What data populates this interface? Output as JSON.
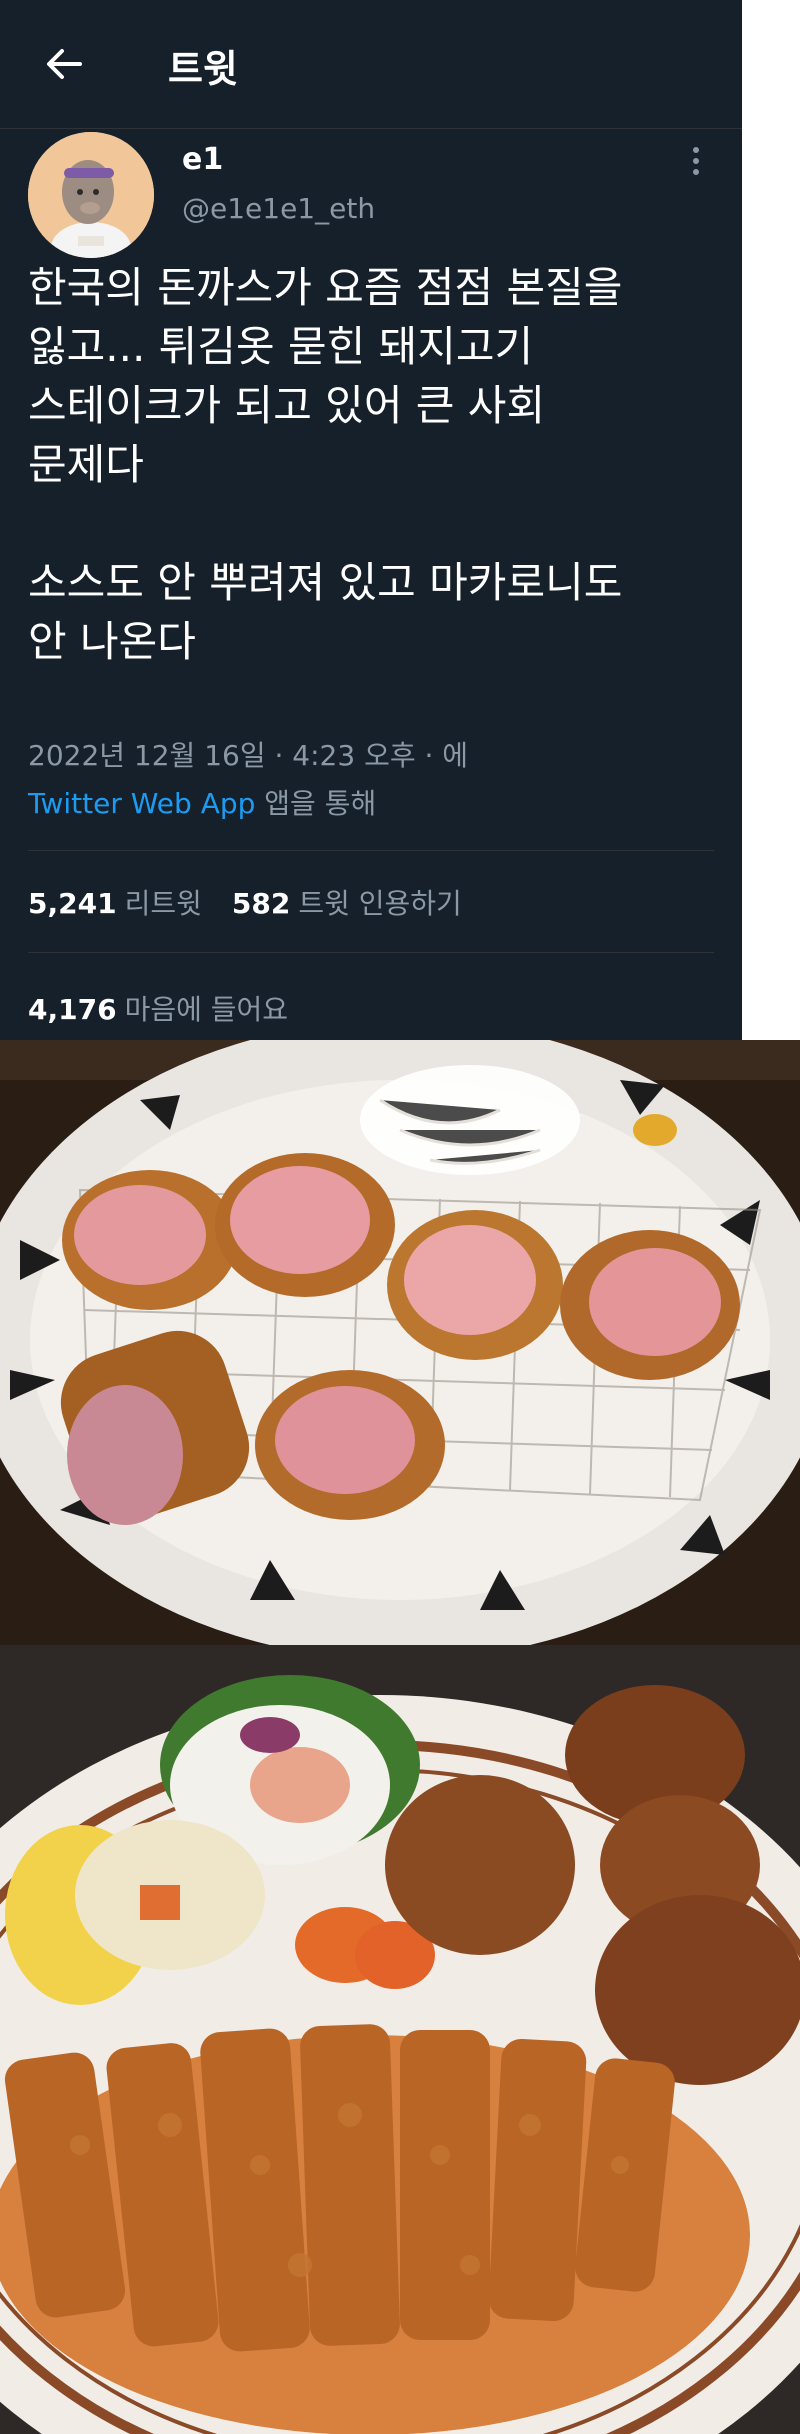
{
  "header": {
    "title": "트윗",
    "back_icon": "arrow-left-icon"
  },
  "user": {
    "display_name": "e1",
    "handle": "@e1e1e1_eth"
  },
  "tweet": {
    "text": "한국의 돈까스가 요즘 점점 본질을\n잃고... 튀김옷 묻힌 돼지고기\n스테이크가 되고 있어 큰 사회\n문제다\n\n소스도 안 뿌려져 있고 마카로니도\n안 나온다",
    "timestamp": "2022년 12월 16일 · 4:23 오후 · 에",
    "source_app": "Twitter Web App",
    "source_suffix": " 앱을 통해"
  },
  "stats": {
    "retweets_count": "5,241",
    "retweets_label": "리트윗",
    "quotes_count": "582",
    "quotes_label": "트윗 인용하기",
    "likes_count": "4,176",
    "likes_label": "마음에 들어요"
  },
  "colors": {
    "background": "#15202b",
    "text": "#ffffff",
    "secondary": "#8b98a5",
    "link": "#1d9bf0",
    "divider": "#2f3336"
  }
}
